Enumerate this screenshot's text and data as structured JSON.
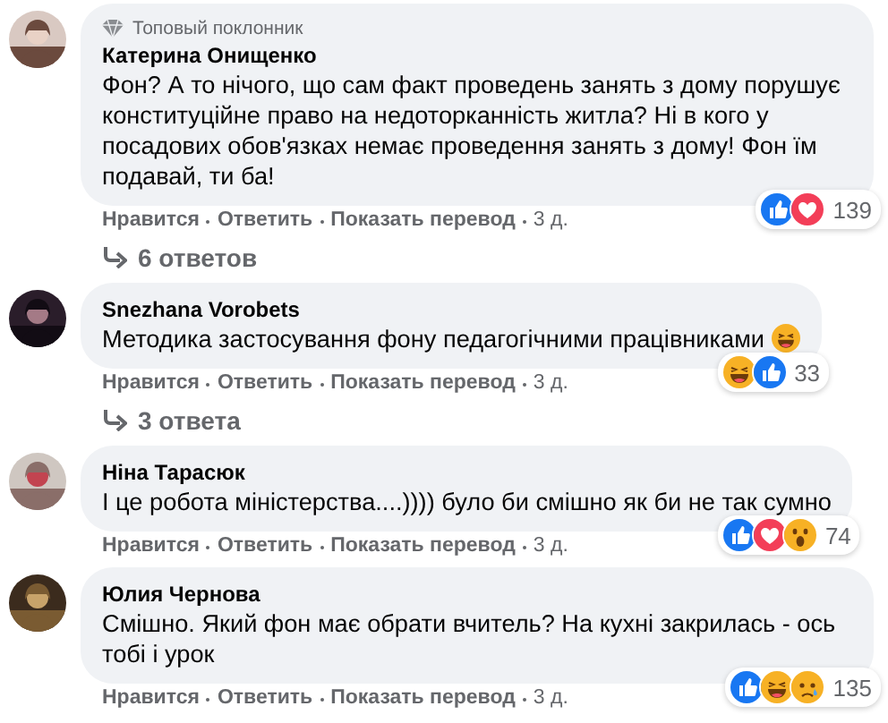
{
  "comments": [
    {
      "badge": "Топовый поклонник",
      "author": "Катерина Онищенко",
      "text": "Фон? А то нічого, що сам факт проведень занять з дому порушує конституційне право на недоторканність житла? Ні в кого у посадових обов'язках немає проведення занять з дому! Фон їм подавай, ти ба!",
      "reactions": [
        {
          "kind": "like"
        },
        {
          "kind": "love"
        }
      ],
      "reaction_count": "139",
      "actions": [
        "Нравится",
        "Ответить",
        "Показать перевод"
      ],
      "time": "3 д.",
      "replies": "6 ответов"
    },
    {
      "author": "Snezhana Vorobets",
      "text": "Методика застосування фону педагогічними працівниками",
      "trailing_emoji": {
        "kind": "haha"
      },
      "reactions": [
        {
          "kind": "haha"
        },
        {
          "kind": "like"
        }
      ],
      "reaction_count": "33",
      "actions": [
        "Нравится",
        "Ответить",
        "Показать перевод"
      ],
      "time": "3 д.",
      "replies": "3 ответа"
    },
    {
      "author": "Ніна Тарасюк",
      "text": "І це робота міністерства....)))) було би смішно як би не так сумно",
      "reactions": [
        {
          "kind": "like"
        },
        {
          "kind": "love"
        },
        {
          "kind": "wow"
        }
      ],
      "reaction_count": "74",
      "actions": [
        "Нравится",
        "Ответить",
        "Показать перевод"
      ],
      "time": "3 д."
    },
    {
      "author": "Юлия Чернова",
      "text": "Смішно. Який фон має обрати вчитель? На кухні закрилась - ось тобі і урок",
      "reactions": [
        {
          "kind": "like"
        },
        {
          "kind": "haha"
        },
        {
          "kind": "sad"
        }
      ],
      "reaction_count": "135",
      "actions": [
        "Нравится",
        "Ответить",
        "Показать перевод"
      ],
      "time": "3 д."
    }
  ]
}
